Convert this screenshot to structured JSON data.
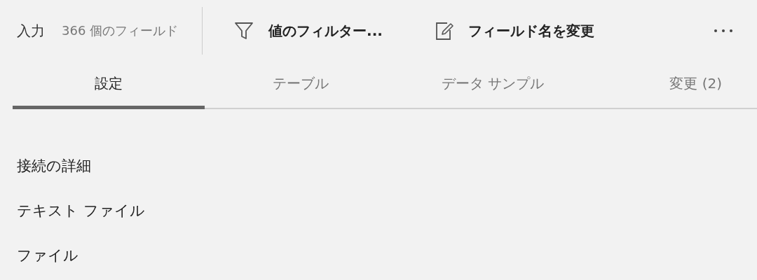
{
  "header": {
    "title": "入力",
    "field_count": "366 個のフィールド"
  },
  "actions": [
    {
      "kind": "filter",
      "label": "値のフィルター..."
    },
    {
      "kind": "rename",
      "label": "フィールド名を変更"
    }
  ],
  "tabs": [
    {
      "label": "設定",
      "selected": true
    },
    {
      "label": "テーブル",
      "selected": false
    },
    {
      "label": "データ サンプル",
      "selected": false
    },
    {
      "label": "変更 (2)",
      "selected": false
    }
  ],
  "sections": [
    "接続の詳細",
    "テキスト ファイル",
    "ファイル"
  ]
}
